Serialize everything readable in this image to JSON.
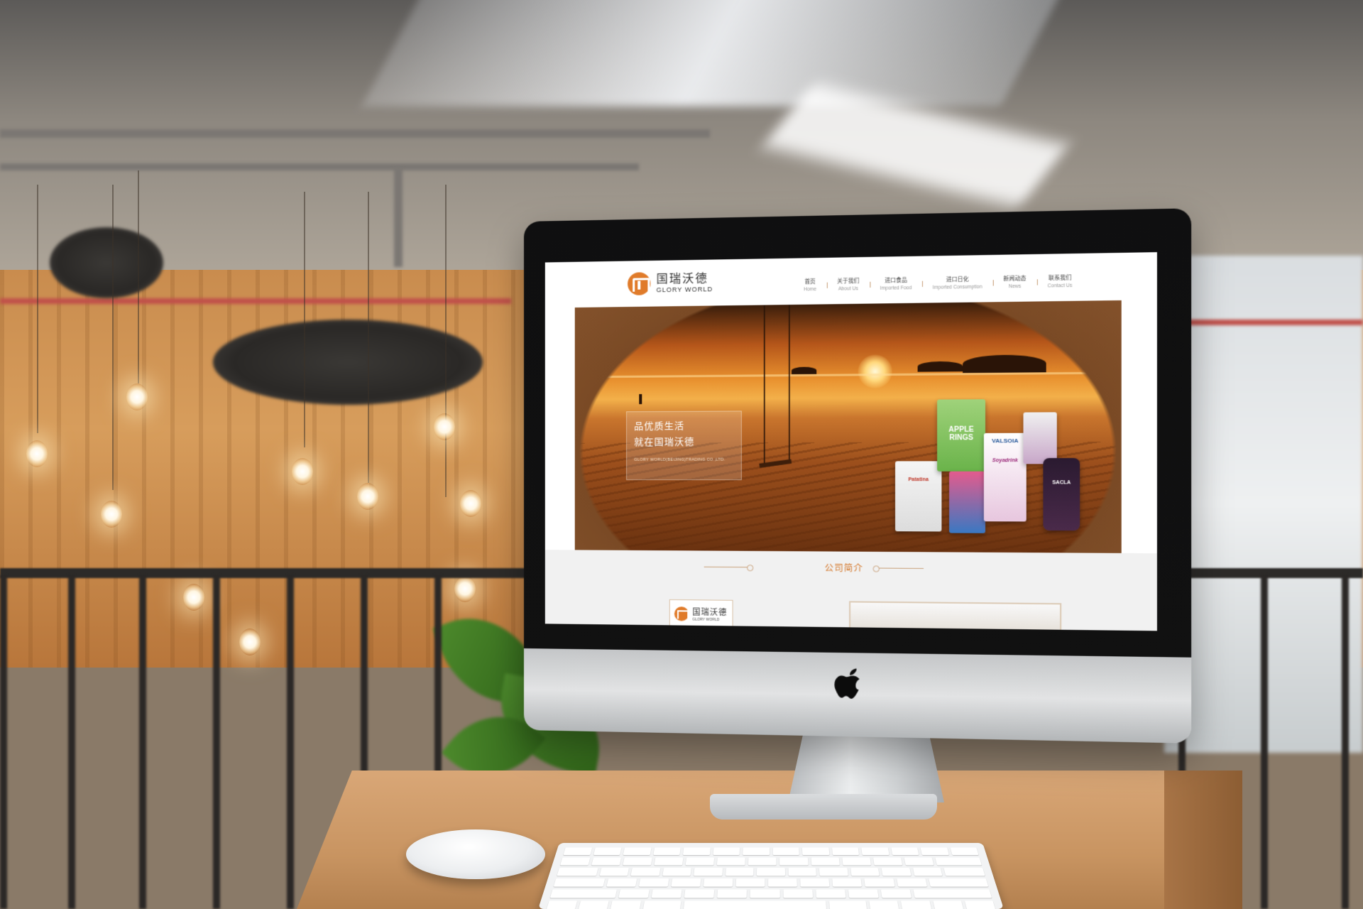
{
  "site": {
    "logo": {
      "cn": "国瑞沃德",
      "en": "GLORY WORLD"
    },
    "nav": [
      {
        "cn": "首页",
        "en": "Home"
      },
      {
        "cn": "关于我们",
        "en": "About Us"
      },
      {
        "cn": "进口食品",
        "en": "Imported Food"
      },
      {
        "cn": "进口日化",
        "en": "Imported Consumption"
      },
      {
        "cn": "新闻动态",
        "en": "News"
      },
      {
        "cn": "联系我们",
        "en": "Contact Us"
      }
    ],
    "banner": {
      "line1": "品优质生活",
      "line2": "就在国瑞沃德",
      "company": "GLORY WORLD(BEIJING)TRADING CO.,LTD."
    },
    "products": [
      "Patatina",
      "APPLE RINGS",
      "VALSOIA",
      "Soyadrink",
      "SACLA"
    ],
    "intro": {
      "title": "公司简介",
      "card": {
        "cn": "国瑞沃德",
        "en": "GLORY WORLD"
      }
    }
  },
  "colors": {
    "brand_orange": "#e07b2a",
    "intro_title": "#d4782c"
  },
  "icons": {
    "device_logo": "apple-logo-icon",
    "brand_logo": "glory-world-logo-icon"
  }
}
